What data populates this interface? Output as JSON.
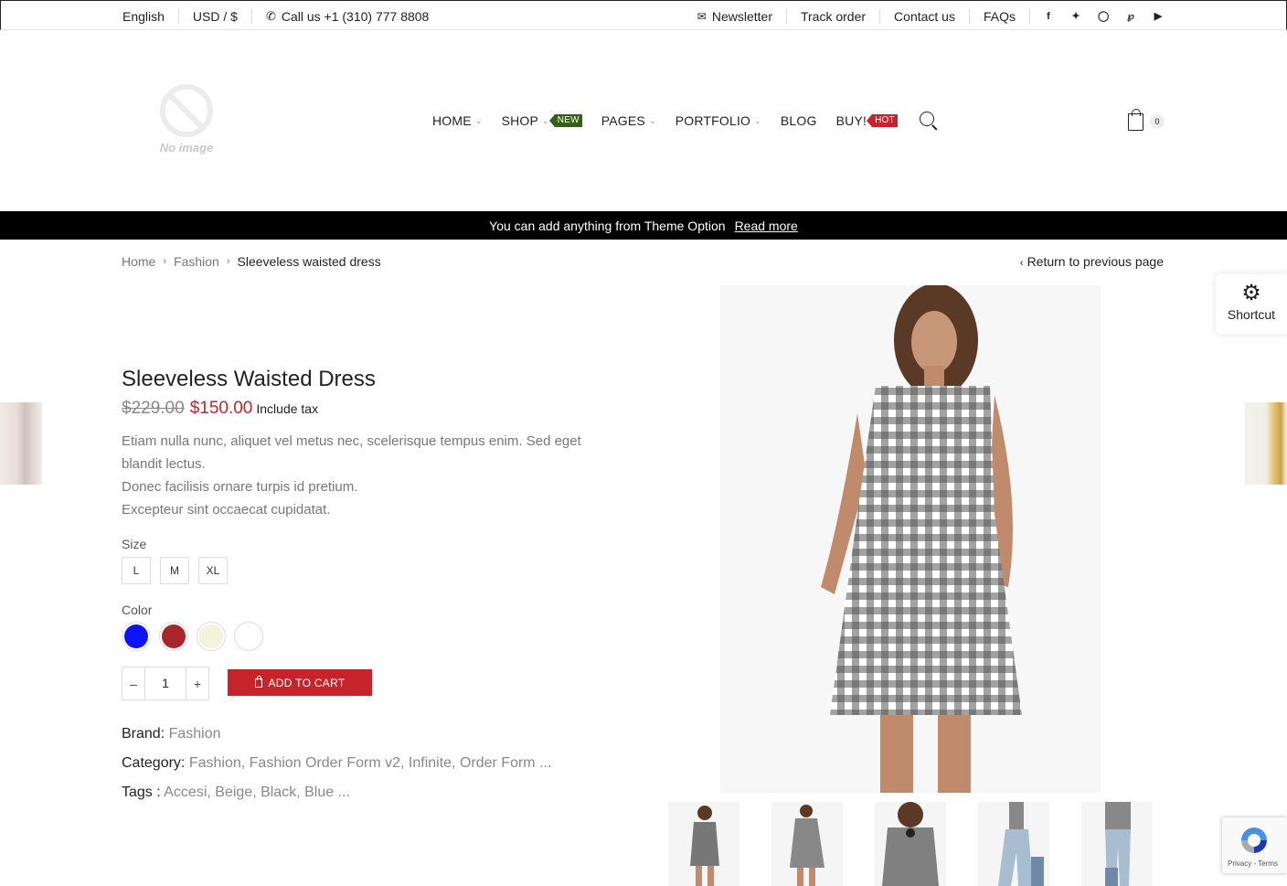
{
  "topbar": {
    "language": "English",
    "currency": "USD / $",
    "phone": "Call us +1 (310) 777 8808",
    "links": [
      "Newsletter",
      "Track order",
      "Contact us",
      "FAQs"
    ],
    "social_icons": [
      "facebook-icon",
      "twitter-icon",
      "instagram-icon",
      "pinterest-icon",
      "youtube-icon"
    ]
  },
  "logo": {
    "placeholder_text": "No image"
  },
  "nav": {
    "items": [
      {
        "label": "HOME",
        "dropdown": true
      },
      {
        "label": "SHOP",
        "dropdown": true,
        "badge": "NEW"
      },
      {
        "label": "PAGES",
        "dropdown": true
      },
      {
        "label": "PORTFOLIO",
        "dropdown": true
      },
      {
        "label": "BLOG",
        "dropdown": false
      },
      {
        "label": "BUY!",
        "dropdown": false,
        "badge": "HOT"
      }
    ]
  },
  "cart": {
    "count": "0"
  },
  "announcement": {
    "text": "You can add anything from Theme Option",
    "link": "Read more"
  },
  "breadcrumb": {
    "home": "Home",
    "category": "Fashion",
    "current": "Sleeveless waisted dress"
  },
  "return_link": "Return to previous page",
  "shortcut": {
    "label": "Shortcut"
  },
  "product": {
    "title": "Sleeveless Waisted Dress",
    "old_price": "$229.00",
    "price": "$150.00",
    "tax_note": "Include tax",
    "description": [
      "Etiam nulla nunc, aliquet vel metus nec, scelerisque tempus enim. Sed eget blandit lectus.",
      "Donec facilisis ornare turpis id pretium.",
      "Excepteur sint occaecat cupidatat."
    ],
    "size_label": "Size",
    "sizes": [
      "L",
      "M",
      "XL"
    ],
    "color_label": "Color",
    "colors": [
      "#0a14f5",
      "#a8262b",
      "#f3f3dc",
      "#ffffff"
    ],
    "quantity": "1",
    "add_to_cart": "ADD TO CART",
    "brand_label": "Brand:",
    "brand": "Fashion",
    "category_label": "Category:",
    "categories": "Fashion, Fashion Order Form v2, Infinite, Order Form ...",
    "tags_label": "Tags :",
    "tags": "Accesi, Beige, Black, Blue ..."
  },
  "recaptcha": {
    "text": "Privacy - Terms"
  },
  "colors": {
    "accent": "#c7232a",
    "new_badge": "#356016",
    "announcement_bg": "#000000"
  }
}
